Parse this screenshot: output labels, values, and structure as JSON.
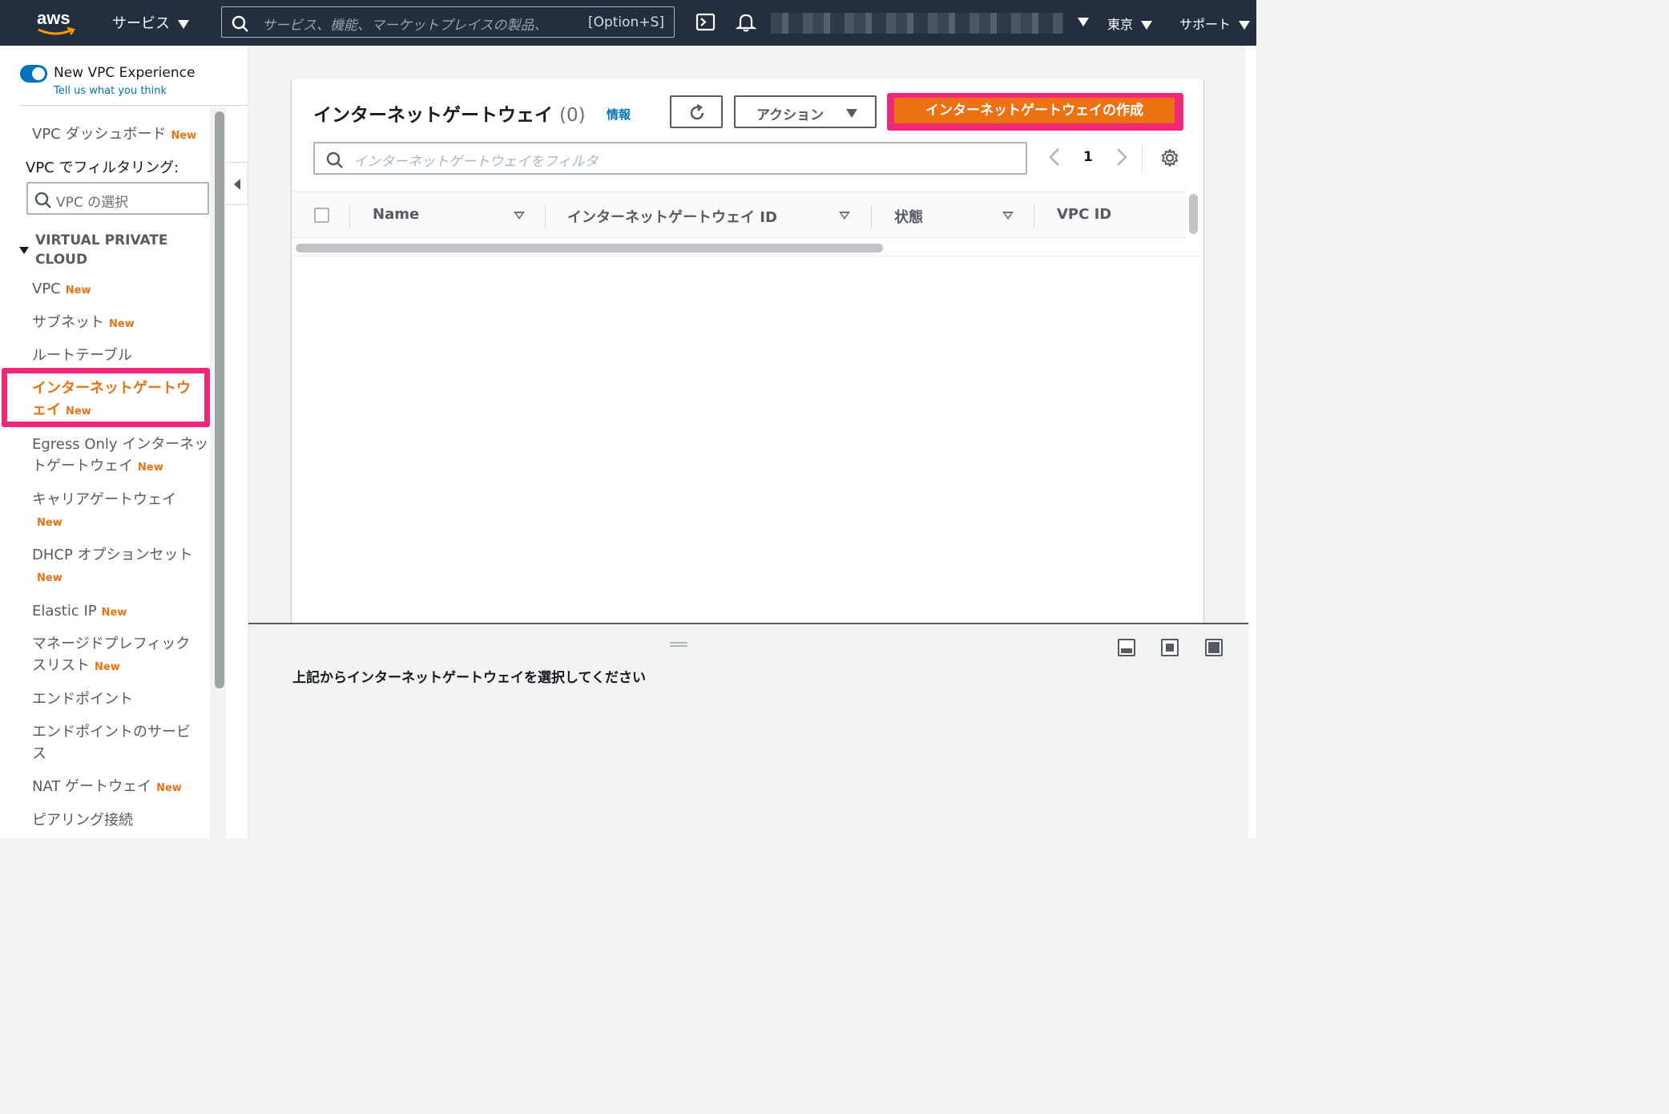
{
  "topnav": {
    "logo_text": "aws",
    "services_label": "サービス",
    "search_placeholder": "サービス、機能、マーケットプレイスの製品、",
    "search_shortcut": "[Option+S]",
    "region_label": "東京",
    "support_label": "サポート"
  },
  "sidebar": {
    "toggle_label": "New VPC Experience",
    "feedback_link": "Tell us what you think",
    "dashboard_label": "VPC ダッシュボード",
    "filter_label": "VPC でフィルタリング:",
    "vpc_select_placeholder": "VPC の選択",
    "section_title": "VIRTUAL PRIVATE CLOUD",
    "new_badge": "New",
    "items": [
      {
        "label": "VPC",
        "new": "New"
      },
      {
        "label": "サブネット",
        "new": "New"
      },
      {
        "label": "ルートテーブル",
        "new": ""
      },
      {
        "label": "インターネットゲートウ",
        "label2": "ェイ",
        "new": "New"
      },
      {
        "label": "Egress Only インターネッ",
        "label2": "トゲートウェイ",
        "new": "New"
      },
      {
        "label": "キャリアゲートウェイ",
        "new": "New"
      },
      {
        "label": "DHCP オプションセット",
        "new": "New"
      },
      {
        "label": "Elastic IP",
        "new": "New"
      },
      {
        "label": "マネージドプレフィック",
        "label2": "スリスト",
        "new": "New"
      },
      {
        "label": "エンドポイント",
        "new": ""
      },
      {
        "label": "エンドポイントのサービ",
        "label2": "ス",
        "new": ""
      },
      {
        "label": "NAT ゲートウェイ",
        "new": "New"
      },
      {
        "label": "ピアリング接続",
        "new": ""
      }
    ]
  },
  "main": {
    "title": "インターネットゲートウェイ",
    "count": "(0)",
    "info_link": "情報",
    "actions_label": "アクション",
    "create_button": "インターネットゲートウェイの作成",
    "filter_placeholder": "インターネットゲートウェイをフィルタ",
    "page_number": "1",
    "columns": [
      "Name",
      "インターネットゲートウェイ ID",
      "状態",
      "VPC ID"
    ]
  },
  "split_panel": {
    "message": "上記からインターネットゲートウェイを選択してください"
  },
  "colors": {
    "nav_bg": "#232f3e",
    "accent_orange": "#ec7211",
    "highlight_pink": "#f0287a",
    "link_blue": "#0073bb"
  }
}
